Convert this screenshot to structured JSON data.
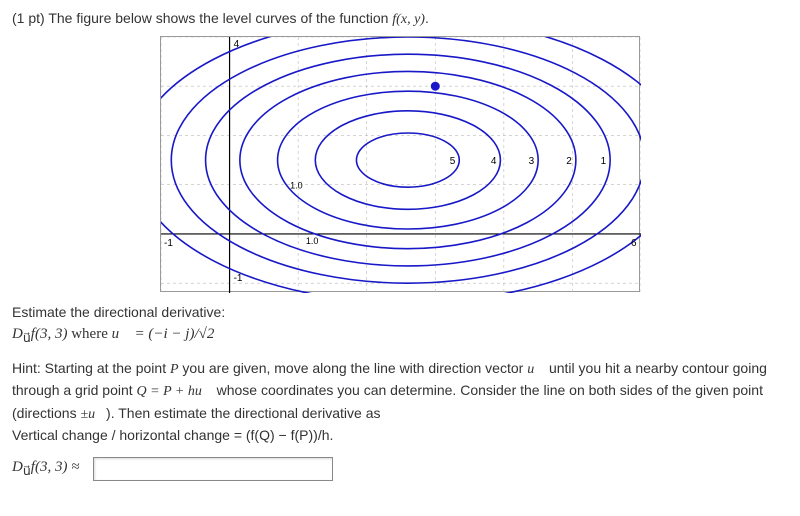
{
  "points": "(1 pt)",
  "intro_text": "The figure below shows the level curves of the function ",
  "func_expr": "f(x, y)",
  "intro_end": ".",
  "estimate_label": "Estimate the directional derivative:",
  "deriv_expr": "D",
  "deriv_sub": "u⃗",
  "deriv_args": "f(3, 3)",
  "where_text": " where ",
  "u_expr": "u⃗ = (−i − j)/√2",
  "hint_prefix": "Hint: Starting at the point ",
  "hint_P": "P",
  "hint_part1": " you are given, move along the line with direction vector ",
  "hint_u": "u⃗",
  "hint_part2": " until you hit a nearby contour going through a grid point ",
  "hint_Q": "Q = P + hu⃗",
  "hint_part3": " whose coordinates you can determine. Consider the line on both sides of the given point (directions ",
  "hint_pm": "±u⃗",
  "hint_part4": "). Then estimate the directional derivative as",
  "hint_ratio": "Vertical change / horizontal change = (f(Q) − f(P))/h.",
  "answer_label_1": "D",
  "answer_label_sub": "u⃗",
  "answer_label_2": "f(3, 3) ≈",
  "chart_data": {
    "type": "contour",
    "title": "",
    "xlim": [
      -1,
      6
    ],
    "ylim": [
      -1.2,
      4
    ],
    "grid": true,
    "marked_point": {
      "x": 3,
      "y": 3
    },
    "axis_ticks_x": [
      -1,
      6
    ],
    "tick_labels_visible": [
      "-1",
      "1.0",
      "-1.0",
      "4",
      "5",
      "4",
      "3",
      "2",
      "1",
      "6",
      "-1"
    ],
    "contour_labels": [
      1,
      2,
      3,
      4,
      5
    ],
    "contours": [
      {
        "cx": 2.6,
        "cy": 1.5,
        "rx": 0.75,
        "ry": 0.55,
        "label": 5
      },
      {
        "cx": 2.6,
        "cy": 1.5,
        "rx": 1.35,
        "ry": 1.0,
        "label": 4
      },
      {
        "cx": 2.6,
        "cy": 1.5,
        "rx": 1.9,
        "ry": 1.4,
        "label": 3
      },
      {
        "cx": 2.6,
        "cy": 1.5,
        "rx": 2.45,
        "ry": 1.8,
        "label": 2
      },
      {
        "cx": 2.6,
        "cy": 1.5,
        "rx": 2.95,
        "ry": 2.15,
        "label": 1
      },
      {
        "cx": 2.6,
        "cy": 1.5,
        "rx": 3.45,
        "ry": 2.5
      },
      {
        "cx": 2.6,
        "cy": 1.5,
        "rx": 4.0,
        "ry": 2.9
      }
    ]
  }
}
